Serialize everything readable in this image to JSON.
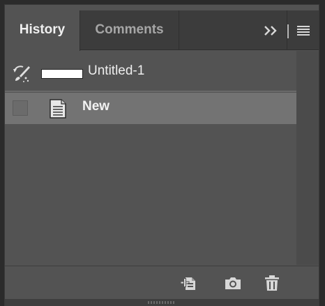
{
  "tabs": [
    {
      "label": "History",
      "active": true
    },
    {
      "label": "Comments",
      "active": false
    }
  ],
  "tabbar_icons": {
    "collapse": "double-chevron-right-icon",
    "menu": "hamburger-menu-icon"
  },
  "history": {
    "snapshot": {
      "label": "Untitled-1",
      "icon": "history-brush-icon"
    },
    "states": [
      {
        "label": "New",
        "icon": "document-icon",
        "selected": true
      }
    ]
  },
  "bottom_toolbar": {
    "icons": [
      "new-document-from-state-icon",
      "camera-snapshot-icon",
      "trash-icon"
    ]
  },
  "colors": {
    "panel_bg": "#535353",
    "tabbar_bg": "#3c3c3c",
    "selected_row": "#737373",
    "text": "#eeeeee"
  }
}
